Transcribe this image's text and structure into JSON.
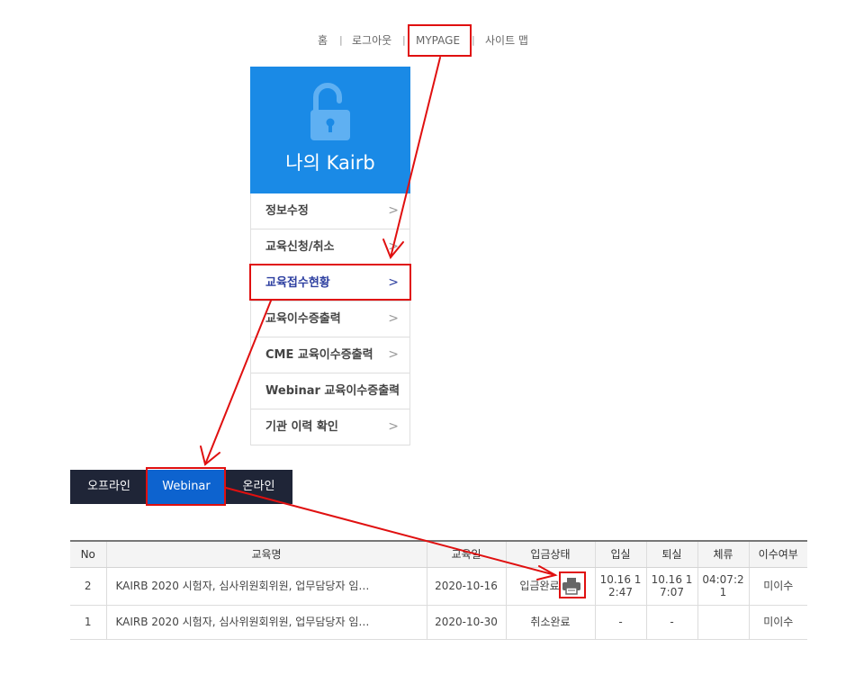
{
  "topnav": {
    "home": "홈",
    "logout": "로그아웃",
    "mypage": "MYPAGE",
    "sitemap": "사이트 맵",
    "separator": "|"
  },
  "sidebar": {
    "title": "나의 Kairb",
    "header_color": "#1a8ae6",
    "icon": "unlock-icon",
    "chevron": ">",
    "items": [
      {
        "label": "정보수정"
      },
      {
        "label": "교육신청/취소"
      },
      {
        "label": "교육접수현황"
      },
      {
        "label": "교육이수증출력"
      },
      {
        "label": "CME 교육이수증출력"
      },
      {
        "label": "Webinar 교육이수증출력"
      },
      {
        "label": "기관 이력 확인"
      }
    ]
  },
  "tabs": [
    {
      "label": "오프라인"
    },
    {
      "label": "Webinar"
    },
    {
      "label": "온라인"
    }
  ],
  "table": {
    "headers": [
      "No",
      "교육명",
      "교육일",
      "입금상태",
      "입실",
      "퇴실",
      "체류",
      "이수여부"
    ],
    "rows": [
      {
        "no": "2",
        "course": "KAIRB 2020 시험자, 심사위원회위원, 업무담당자 임…",
        "date": "2020-10-16",
        "payment": "입금완료",
        "has_print_icon": true,
        "checkin": "10.16 12:47",
        "checkout": "10.16 17:07",
        "stay": "04:07:21",
        "completion": "미이수"
      },
      {
        "no": "1",
        "course": "KAIRB 2020 시험자, 심사위원회위원, 업무담당자 임…",
        "date": "2020-10-30",
        "payment": "취소완료",
        "has_print_icon": false,
        "checkin": "-",
        "checkout": "-",
        "stay": "",
        "completion": "미이수"
      }
    ]
  },
  "colors": {
    "accent_blue": "#1a8ae6",
    "active_tab": "#0d63cf",
    "dark_tab": "#1f2537",
    "annotation_red": "#e01010",
    "active_menu_text": "#2d3fa0"
  }
}
